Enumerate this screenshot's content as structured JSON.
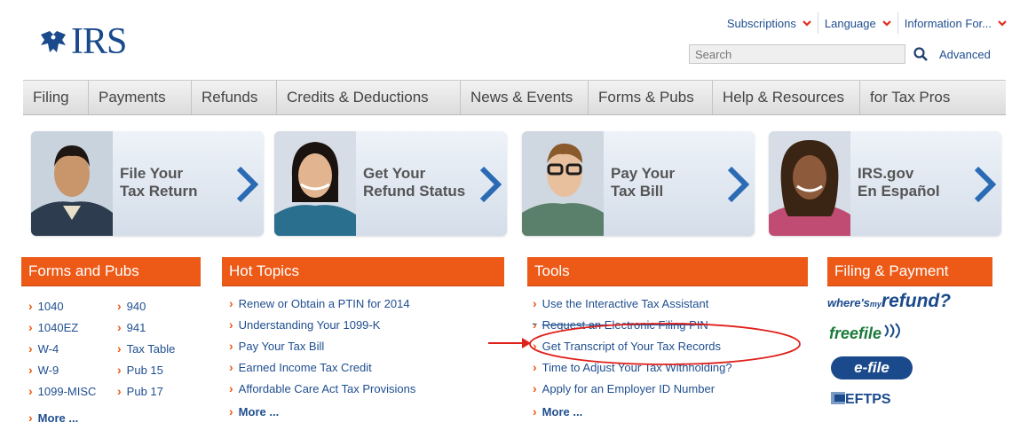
{
  "header": {
    "logo_text": "IRS",
    "util_nav": [
      "Subscriptions",
      "Language",
      "Information For..."
    ],
    "search_placeholder": "Search",
    "advanced_label": "Advanced"
  },
  "main_nav": [
    "Filing",
    "Payments",
    "Refunds",
    "Credits & Deductions",
    "News & Events",
    "Forms & Pubs",
    "Help & Resources",
    "for Tax Pros"
  ],
  "tiles": [
    {
      "line1": "File Your",
      "line2": "Tax Return"
    },
    {
      "line1": "Get Your",
      "line2": "Refund Status"
    },
    {
      "line1": "Pay Your",
      "line2": "Tax Bill"
    },
    {
      "line1": "IRS.gov",
      "line2": "En Español"
    }
  ],
  "forms_and_pubs": {
    "title": "Forms and Pubs",
    "col1": [
      "1040",
      "1040EZ",
      "W-4",
      "W-9",
      "1099-MISC"
    ],
    "col2": [
      "940",
      "941",
      "Tax Table",
      "Pub 15",
      "Pub 17"
    ],
    "more": "More ..."
  },
  "hot_topics": {
    "title": "Hot Topics",
    "items": [
      "Renew or Obtain a PTIN for 2014",
      "Understanding Your 1099-K",
      "Pay Your Tax Bill",
      "Earned Income Tax Credit",
      "Affordable Care Act Tax Provisions"
    ],
    "more": "More ..."
  },
  "tools": {
    "title": "Tools",
    "items": [
      "Use the Interactive Tax Assistant",
      "Request an Electronic Filing PIN",
      "Get Transcript of Your Tax Records",
      "Time to Adjust Your Tax Withholding?",
      "Apply for an Employer ID Number"
    ],
    "more": "More ..."
  },
  "filing_payment": {
    "title": "Filing & Payment",
    "wheres_small": "where's",
    "wheres_mid": "my",
    "wheres_big": "refund?",
    "freefile": "freefile",
    "efile": "e-file",
    "eftps": "EFTPS"
  },
  "colors": {
    "brand_blue": "#1a4a8c",
    "accent_orange": "#ed5a17",
    "annotation_red": "#e0201a"
  }
}
